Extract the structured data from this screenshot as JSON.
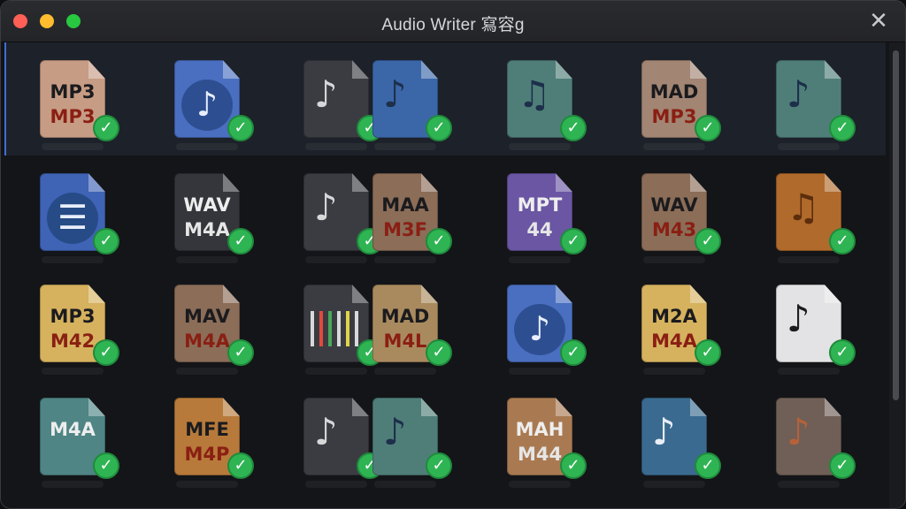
{
  "window": {
    "title": "Audio Writer 寫容g",
    "close_glyph": "✕"
  },
  "check_glyph": "✓",
  "rows": [
    [
      {
        "kind": "text",
        "color": "#c79c84",
        "t1": "MP3",
        "t2": "MP3"
      },
      {
        "kind": "circle",
        "color": "#4a6fc0"
      },
      {
        "kind": "note",
        "color": "#3a3c42",
        "note": "♪"
      },
      {
        "kind": "note",
        "color": "#3b67a9",
        "note": "♪"
      },
      {
        "kind": "note",
        "color": "#4f7e79",
        "note": "♫"
      },
      {
        "kind": "text",
        "color": "#a28573",
        "t1": "MAD",
        "t2": "MP3"
      },
      {
        "kind": "note",
        "color": "#4f7e79",
        "note": "♪"
      }
    ],
    [
      {
        "kind": "list",
        "color": "#3f63b5"
      },
      {
        "kind": "text",
        "color": "#35363b",
        "t1": "WAV",
        "t2": "M4A",
        "light": true
      },
      {
        "kind": "note",
        "color": "#3a3c42",
        "note": "♪"
      },
      {
        "kind": "text",
        "color": "#8b6d58",
        "t1": "MAA",
        "t2": "M3F"
      },
      {
        "kind": "text",
        "color": "#6a56a3",
        "t1": "MPT",
        "t2": "44",
        "light": true
      },
      {
        "kind": "text",
        "color": "#8b6d58",
        "t1": "WAV",
        "t2": "M43"
      },
      {
        "kind": "note",
        "color": "#b06a2b",
        "note": "♫"
      }
    ],
    [
      {
        "kind": "text",
        "color": "#d6b25e",
        "t1": "MP3",
        "t2": "M42"
      },
      {
        "kind": "text",
        "color": "#8b6d58",
        "t1": "MAV",
        "t2": "M4A"
      },
      {
        "kind": "eq",
        "color": "#3a3c42"
      },
      {
        "kind": "text",
        "color": "#a98a5e",
        "t1": "MAD",
        "t2": "M4L"
      },
      {
        "kind": "circle",
        "color": "#4a6fc0"
      },
      {
        "kind": "text",
        "color": "#d6b25e",
        "t1": "M2A",
        "t2": "M4A"
      },
      {
        "kind": "note",
        "color": "#e3e3e5",
        "note": "♪"
      }
    ],
    [
      {
        "kind": "text",
        "color": "#4f8584",
        "t1": "M4A",
        "t2": "",
        "light": true
      },
      {
        "kind": "text",
        "color": "#b77a3a",
        "t1": "MFE",
        "t2": "M4P"
      },
      {
        "kind": "note",
        "color": "#3a3c42",
        "note": "♪"
      },
      {
        "kind": "note",
        "color": "#4f7e79",
        "note": "♪"
      },
      {
        "kind": "text",
        "color": "#a97a52",
        "t1": "MAH",
        "t2": "M44",
        "light": true
      },
      {
        "kind": "note",
        "color": "#3a6a8f",
        "note": "♪"
      },
      {
        "kind": "note",
        "color": "#6f5f56",
        "note": "♪"
      }
    ]
  ]
}
